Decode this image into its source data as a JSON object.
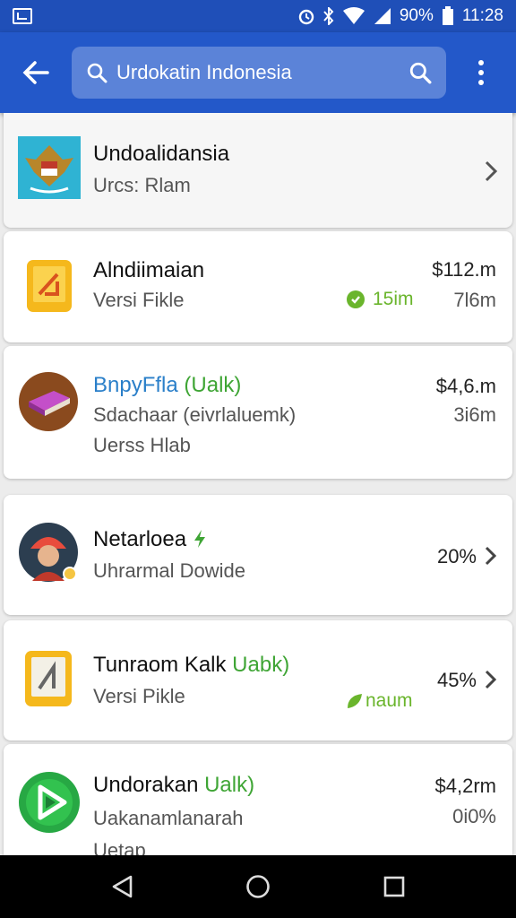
{
  "status": {
    "battery": "90%",
    "time": "11:28"
  },
  "search": {
    "query": "Urdokatin Indonesia"
  },
  "results": [
    {
      "title": "Undoalidansia",
      "subtitle": "Urcs: Rlam"
    },
    {
      "title": "Alndiimaian",
      "subtitle": "Versi Fikle",
      "badge": "15im",
      "price": "$112.m",
      "size": "7l6m"
    },
    {
      "title": "BnpyFfla ",
      "title_highlight": "(Ualk)",
      "subtitle": "Sdachaar (eivrlaluemk)",
      "subtitle2": "Uerss Hlab",
      "price": "$4,6.m",
      "size": "3i6m"
    },
    {
      "title": "Netarloea",
      "subtitle": "Uhrarmal Dowide",
      "percent": "20%"
    },
    {
      "title": "Tunraom Kalk ",
      "title_highlight": "Uabk)",
      "subtitle": "Versi Pikle",
      "badge": "naum",
      "percent": "45%"
    },
    {
      "title": "Undorakan ",
      "title_highlight": "Ualk)",
      "subtitle": "Uakanamlanarah",
      "subtitle2": "Uetap",
      "price": "$4,2rm",
      "size": "0i0%"
    }
  ],
  "colors": {
    "app_bar": "#2358c9",
    "status_bar": "#1f4fb8",
    "search_box": "#5b83d8",
    "accent_green": "#3fa535",
    "accent_blue": "#2a7fc9"
  }
}
